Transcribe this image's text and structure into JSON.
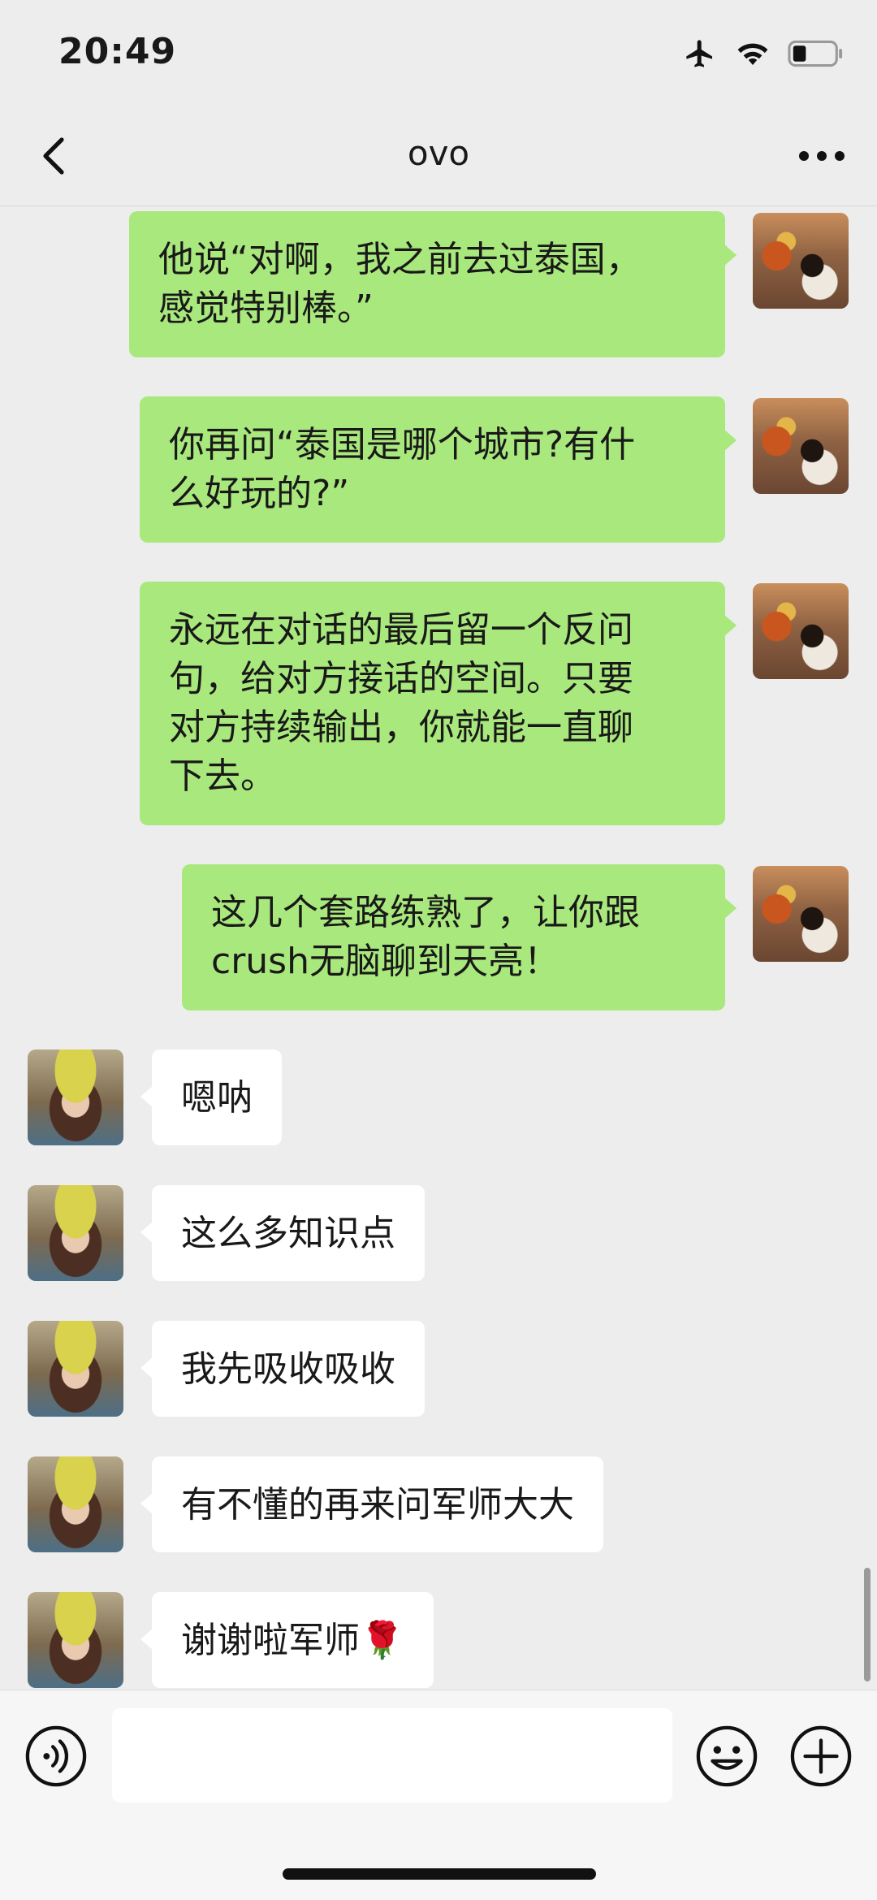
{
  "status": {
    "time": "20:49"
  },
  "nav": {
    "title": "ovo"
  },
  "messages": [
    {
      "side": "right",
      "text": "他说“对啊，我之前去过泰国，\n感觉特别棒。”"
    },
    {
      "side": "right",
      "text": "你再问“泰国是哪个城市?有什\n么好玩的?”"
    },
    {
      "side": "right",
      "text": "永远在对话的最后留一个反问\n句，给对方接话的空间。只要\n对方持续输出，你就能一直聊\n下去。"
    },
    {
      "side": "right",
      "text": "这几个套路练熟了，让你跟\ncrush无脑聊到天亮！"
    },
    {
      "side": "left",
      "text": "嗯呐"
    },
    {
      "side": "left",
      "text": "这么多知识点"
    },
    {
      "side": "left",
      "text": "我先吸收吸收"
    },
    {
      "side": "left",
      "text": "有不懂的再来问军师大大"
    },
    {
      "side": "left",
      "text": "谢谢啦军师🌹"
    }
  ],
  "input": {
    "placeholder": ""
  },
  "icons": {
    "back": "chevron-left-icon",
    "more": "more-dots-icon",
    "voice": "voice-icon",
    "emoji": "emoji-icon",
    "plus": "plus-icon",
    "airplane": "airplane-icon",
    "wifi": "wifi-icon",
    "battery": "battery-icon"
  },
  "colors": {
    "background": "#ededed",
    "sent_bubble": "#a9e87d",
    "received_bubble": "#ffffff"
  }
}
